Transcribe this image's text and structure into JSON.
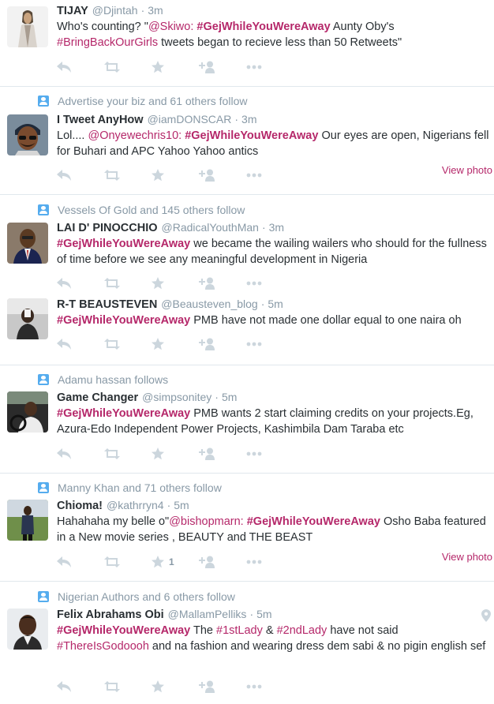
{
  "colors": {
    "accent": "#b5286a",
    "muted": "#8899a6",
    "text": "#292f33",
    "context_icon": "#55acee"
  },
  "tweets": [
    {
      "name": "TIJAY",
      "handle": "@Djintah",
      "time": "3m",
      "text_parts": [
        "Who's counting? \"",
        "@Skiwo",
        ": ",
        "#GejWhileYouWereAway",
        " Aunty Oby's ",
        "#BringBackOurGirls",
        " tweets began to recieve less than 50 Retweets\""
      ]
    },
    {
      "context": "Advertise your biz and 61 others follow",
      "name": "I Tweet AnyHow",
      "handle": "@iamDONSCAR",
      "time": "3m",
      "text_parts": [
        "Lol.... ",
        "@Onyewechris10",
        ": ",
        "#GejWhileYouWereAway",
        " Our eyes are open, Nigerians fell for Buhari and APC Yahoo Yahoo antics"
      ],
      "view_photo": "View photo"
    },
    {
      "context": "Vessels Of Gold and 145 others follow",
      "name": "LAI D' PINOCCHIO",
      "handle": "@RadicalYouthMan",
      "time": "3m",
      "text_parts": [
        "#GejWhileYouWereAway",
        " we became the wailing wailers who should for the fullness of time before we see any meaningful development in Nigeria"
      ]
    },
    {
      "name": "R-T BEAUSTEVEN",
      "handle": "@Beausteven_blog",
      "dot": "·",
      "time": "5m",
      "text_parts": [
        "#GejWhileYouWereAway",
        " PMB have not made one dollar equal to one naira oh"
      ]
    },
    {
      "context": "Adamu hassan follows",
      "name": "Game Changer",
      "handle": "@simpsonitey",
      "dot": "·",
      "time": "5m",
      "text_parts": [
        "#GejWhileYouWereAway",
        " PMB wants 2 start claiming credits on your projects.Eg, Azura-Edo Independent Power Projects, Kashimbila Dam Taraba etc"
      ]
    },
    {
      "context": "Manny Khan and 71 others follow",
      "name": "Chioma!",
      "handle": "@kathrryn4",
      "dot": "·",
      "time": "5m",
      "text_parts": [
        "Hahahaha my belle o\"",
        "@bishopmarn",
        ": ",
        "#GejWhileYouWereAway",
        " Osho Baba featured in a New movie series , BEAUTY and THE BEAST"
      ],
      "favorite_count": "1",
      "view_photo": "View photo"
    },
    {
      "context": "Nigerian Authors and 6 others follow",
      "name": "Felix Abrahams Obi",
      "handle": "@MallamPelliks",
      "dot": "·",
      "time": "5m",
      "text_parts": [
        "#GejWhileYouWereAway",
        " The ",
        "#1stLady",
        " & ",
        "#2ndLady",
        " have not said ",
        "#ThereIsGodoooh",
        " and na fashion and wearing dress dem sabi & no pigin english sef"
      ]
    }
  ],
  "icons": [
    "reply-icon",
    "retweet-icon",
    "favorite-icon",
    "follow-icon",
    "more-icon",
    "location-pin-icon",
    "follow-context-icon"
  ]
}
